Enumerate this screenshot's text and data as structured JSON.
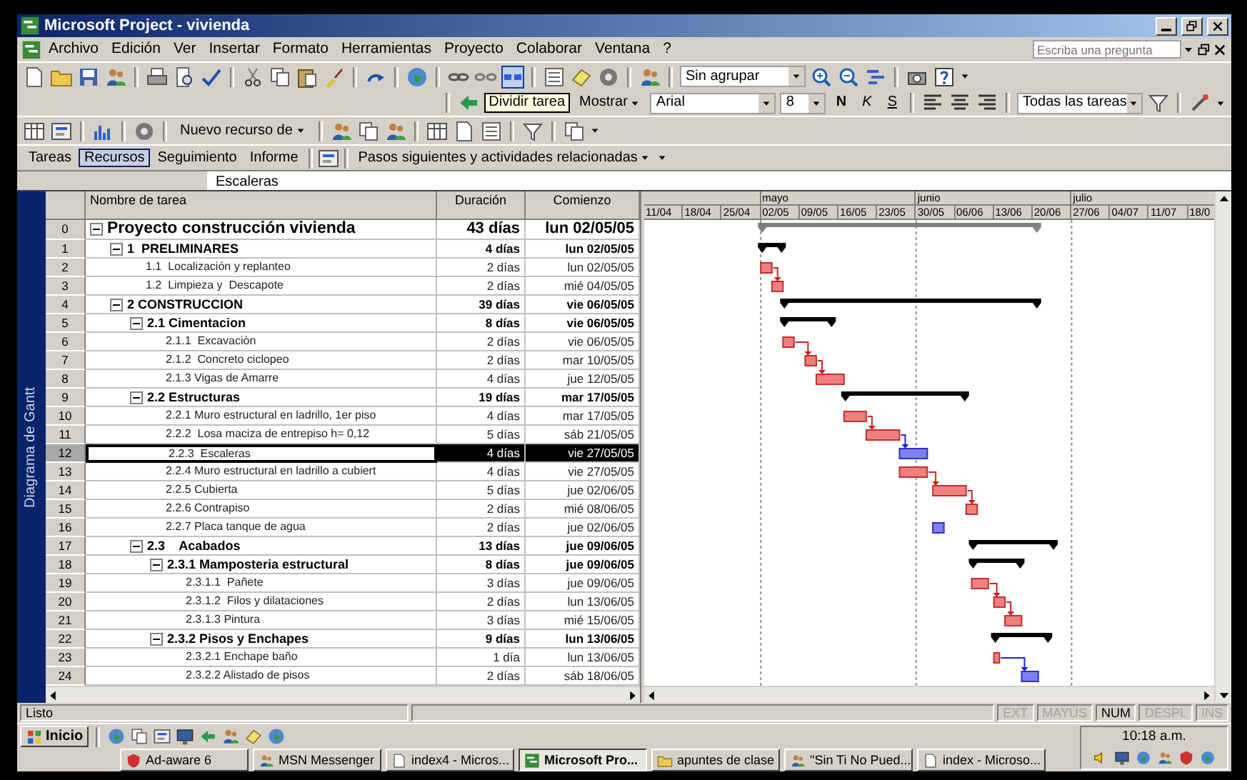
{
  "window": {
    "title": "Microsoft Project - vivienda"
  },
  "menu": [
    "Archivo",
    "Edición",
    "Ver",
    "Insertar",
    "Formato",
    "Herramientas",
    "Proyecto",
    "Colaborar",
    "Ventana",
    "?"
  ],
  "help_box": {
    "placeholder": "Escriba una pregunta"
  },
  "toolbar_standard": {
    "group_by": "Sin agrupar"
  },
  "tooltip": "Dividir tarea",
  "toolbar_format": {
    "show_menu": "Mostrar",
    "font": "Arial",
    "size": "8",
    "bold": "N",
    "italic": "K",
    "underline": "S",
    "filter": "Todas las tareas"
  },
  "toolbar_resource": {
    "new_resource_menu": "Nuevo recurso de"
  },
  "view_bar": {
    "tabs": [
      {
        "label": "Tareas",
        "selected": false
      },
      {
        "label": "Recursos",
        "selected": true
      },
      {
        "label": "Seguimiento",
        "selected": false
      },
      {
        "label": "Informe",
        "selected": false
      }
    ],
    "guide_menu": "Pasos siguientes y actividades relacionadas"
  },
  "entry_bar": {
    "value": "Escaleras"
  },
  "view_label": "Diagrama de Gantt",
  "table": {
    "columns": [
      "Nombre de tarea",
      "Duración",
      "Comienzo"
    ],
    "tasks": [
      {
        "id": "0",
        "name": "Proyecto construcción vivienda",
        "duration": "43 días",
        "start": "lun 02/05/05",
        "expanded": true,
        "selected": false,
        "children": [
          {
            "id": "1",
            "name": "1  PRELIMINARES",
            "duration": "4 días",
            "start": "lun 02/05/05",
            "expanded": true,
            "selected": false,
            "children": [
              {
                "id": "2",
                "name": "1.1  Localización y replanteo",
                "duration": "2 días",
                "start": "lun 02/05/05",
                "selected": false,
                "critical": true
              },
              {
                "id": "3",
                "name": "1.2  Limpieza y  Descapote",
                "duration": "2 días",
                "start": "mié 04/05/05",
                "selected": false,
                "critical": true
              }
            ]
          },
          {
            "id": "4",
            "name": "2 CONSTRUCCION",
            "duration": "39 días",
            "start": "vie 06/05/05",
            "expanded": true,
            "selected": false,
            "children": [
              {
                "id": "5",
                "name": "2.1 Cimentacion",
                "duration": "8 días",
                "start": "vie 06/05/05",
                "expanded": true,
                "selected": false,
                "children": [
                  {
                    "id": "6",
                    "name": "2.1.1  Excavaciòn",
                    "duration": "2 días",
                    "start": "vie 06/05/05",
                    "selected": false,
                    "critical": true
                  },
                  {
                    "id": "7",
                    "name": "2.1.2  Concreto ciclopeo",
                    "duration": "2 días",
                    "start": "mar 10/05/05",
                    "selected": false,
                    "critical": true
                  },
                  {
                    "id": "8",
                    "name": "2.1.3 Vigas de Amarre",
                    "duration": "4 días",
                    "start": "jue 12/05/05",
                    "selected": false,
                    "critical": true
                  }
                ]
              },
              {
                "id": "9",
                "name": "2.2 Estructuras",
                "duration": "19 días",
                "start": "mar 17/05/05",
                "expanded": true,
                "selected": false,
                "children": [
                  {
                    "id": "10",
                    "name": "2.2.1 Muro estructural en ladrillo, 1er piso",
                    "duration": "4 días",
                    "start": "mar 17/05/05",
                    "selected": false,
                    "critical": true
                  },
                  {
                    "id": "11",
                    "name": "2.2.2  Losa maciza de entrepiso h= 0,12",
                    "duration": "5 días",
                    "start": "sáb 21/05/05",
                    "selected": false,
                    "critical": true
                  },
                  {
                    "id": "12",
                    "name": "2.2.3  Escaleras",
                    "duration": "4 días",
                    "start": "vie 27/05/05",
                    "selected": true,
                    "critical": false
                  },
                  {
                    "id": "13",
                    "name": "2.2.4 Muro estructural en ladrillo a cubiert",
                    "duration": "4 días",
                    "start": "vie 27/05/05",
                    "selected": false,
                    "critical": true
                  },
                  {
                    "id": "14",
                    "name": "2.2.5 Cubierta",
                    "duration": "5 días",
                    "start": "jue 02/06/05",
                    "selected": false,
                    "critical": true
                  },
                  {
                    "id": "15",
                    "name": "2.2.6 Contrapiso",
                    "duration": "2 días",
                    "start": "mié 08/06/05",
                    "selected": false,
                    "critical": true
                  },
                  {
                    "id": "16",
                    "name": "2.2.7 Placa tanque de agua",
                    "duration": "2 días",
                    "start": "jue 02/06/05",
                    "selected": false,
                    "critical": false
                  }
                ]
              },
              {
                "id": "17",
                "name": "2.3    Acabados",
                "duration": "13 días",
                "start": "jue 09/06/05",
                "expanded": true,
                "selected": false,
                "children": [
                  {
                    "id": "18",
                    "name": "2.3.1 Mamposteria estructural",
                    "duration": "8 días",
                    "start": "jue 09/06/05",
                    "expanded": true,
                    "selected": false,
                    "children": [
                      {
                        "id": "19",
                        "name": "2.3.1.1  Pañete",
                        "duration": "3 días",
                        "start": "jue 09/06/05",
                        "selected": false,
                        "critical": true
                      },
                      {
                        "id": "20",
                        "name": "2.3.1.2  Filos y dilataciones",
                        "duration": "2 días",
                        "start": "lun 13/06/05",
                        "selected": false,
                        "critical": true
                      },
                      {
                        "id": "21",
                        "name": "2.3.1.3 Pintura",
                        "duration": "3 días",
                        "start": "mié 15/06/05",
                        "selected": false,
                        "critical": true
                      }
                    ]
                  },
                  {
                    "id": "22",
                    "name": "2.3.2 Pisos y Enchapes",
                    "duration": "9 días",
                    "start": "lun 13/06/05",
                    "expanded": true,
                    "selected": false,
                    "children": [
                      {
                        "id": "23",
                        "name": "2.3.2.1 Enchape baño",
                        "duration": "1 día",
                        "start": "lun 13/06/05",
                        "selected": false,
                        "critical": true
                      },
                      {
                        "id": "24",
                        "name": "2.3.2.2 Alistado de pisos",
                        "duration": "2 días",
                        "start": "sáb 18/06/05",
                        "selected": false,
                        "critical": false
                      }
                    ]
                  }
                ]
              }
            ]
          }
        ]
      }
    ]
  },
  "timeline": [
    {
      "weeks": [
        "11/04",
        "18/04",
        "25/04"
      ]
    },
    {
      "month": "mayo",
      "weeks": [
        "02/05",
        "09/05",
        "16/05",
        "23/05"
      ]
    },
    {
      "month": "junio",
      "weeks": [
        "30/05",
        "06/06",
        "13/06",
        "20/06"
      ]
    },
    {
      "month": "julio",
      "weeks": [
        "27/06",
        "04/07",
        "11/07",
        "18/0"
      ]
    }
  ],
  "status_bar": {
    "text": "Listo",
    "indicators": [
      {
        "label": "EXT",
        "on": false
      },
      {
        "label": "MAYÚS",
        "on": false
      },
      {
        "label": "NUM",
        "on": true
      },
      {
        "label": "DESPL",
        "on": false
      },
      {
        "label": "INS",
        "on": false
      }
    ]
  },
  "taskbar": {
    "start": "Inicio",
    "tasks": [
      {
        "label": "Ad-aware 6",
        "selected": false
      },
      {
        "label": "MSN Messenger",
        "selected": false
      },
      {
        "label": "index4 - Micros...",
        "selected": false
      },
      {
        "label": "Microsoft Pro...",
        "selected": true
      },
      {
        "label": "apuntes de clase",
        "selected": false
      },
      {
        "label": "\"Sin Ti No Pued...",
        "selected": false
      },
      {
        "label": "index - Microso...",
        "selected": false
      }
    ],
    "clock": "10:18 a.m."
  }
}
